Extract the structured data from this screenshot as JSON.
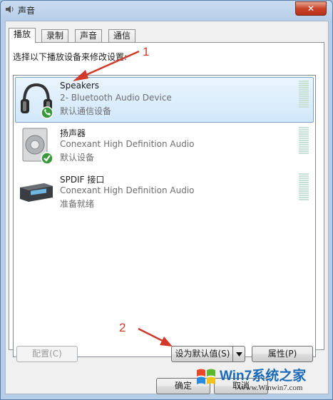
{
  "window": {
    "title": "声音",
    "close_label": "✕"
  },
  "tabs": [
    {
      "label": "播放",
      "active": true
    },
    {
      "label": "录制",
      "active": false
    },
    {
      "label": "声音",
      "active": false
    },
    {
      "label": "通信",
      "active": false
    }
  ],
  "instruction": "选择以下播放设备来修改设置:",
  "devices": [
    {
      "name": "Speakers",
      "description": "2- Bluetooth Audio Device",
      "status": "默认通信设备",
      "icon": "headphones-icon",
      "badge": "phone-badge-icon",
      "selected": true
    },
    {
      "name": "扬声器",
      "description": "Conexant High Definition Audio",
      "status": "默认设备",
      "icon": "speaker-icon",
      "badge": "check-badge-icon",
      "selected": false
    },
    {
      "name": "SPDIF 接口",
      "description": "Conexant High Definition Audio",
      "status": "准备就绪",
      "icon": "spdif-device-icon",
      "badge": "",
      "selected": false
    }
  ],
  "buttons": {
    "configure": "配置(C)",
    "set_default": "设为默认值(S)",
    "properties": "属性(P)",
    "ok": "确定",
    "cancel": "取消"
  },
  "annotations": {
    "step1": "1",
    "step2": "2"
  },
  "watermark": {
    "brand": "Win7系统之家",
    "url": "Www.Winwin7.com"
  },
  "colors": {
    "accent": "#7da2ce",
    "annotation": "#d03a2a",
    "close": "#c8452a"
  }
}
